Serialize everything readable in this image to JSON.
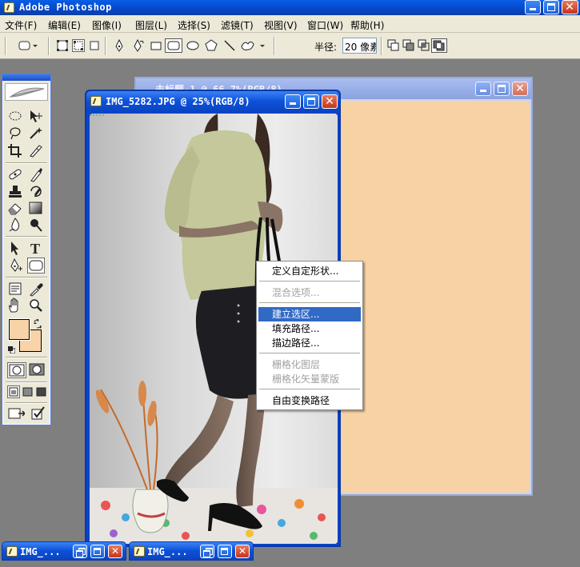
{
  "app": {
    "title": "Adobe Photoshop",
    "icon": "photoshop-feather-icon"
  },
  "menubar": {
    "items": [
      {
        "label": "文件(F)"
      },
      {
        "label": "编辑(E)"
      },
      {
        "label": "图像(I)"
      },
      {
        "label": "图层(L)"
      },
      {
        "label": "选择(S)"
      },
      {
        "label": "滤镜(T)"
      },
      {
        "label": "视图(V)"
      },
      {
        "label": "窗口(W)"
      },
      {
        "label": "帮助(H)"
      }
    ]
  },
  "options": {
    "radius_label": "半径:",
    "radius_value": "20 像素",
    "tool_preset_icon": "rounded-rectangle-preset-icon",
    "mode_icons": [
      "shape-layers-icon",
      "paths-icon",
      "fill-pixels-icon"
    ],
    "shape_icons": [
      "pen-icon",
      "freeform-pen-icon",
      "rectangle-icon",
      "rounded-rectangle-icon",
      "ellipse-icon",
      "polygon-icon",
      "line-icon",
      "custom-shape-icon"
    ],
    "combine_icons": [
      "add-to-shape-icon",
      "subtract-shape-icon",
      "intersect-shape-icon",
      "exclude-shape-icon"
    ]
  },
  "toolbox": {
    "foreground_color": "#f8d2a8",
    "background_color": "#f8d2a8",
    "active_tool": "rounded-rectangle-tool"
  },
  "documents": {
    "front": {
      "title": "IMG_5282.JPG @ 25%(RGB/8)"
    },
    "back": {
      "title": "未标题-1 @ 66.7%(RGB/8)",
      "canvas_color": "#f7d2a4"
    }
  },
  "context_menu": {
    "items": [
      {
        "label": "定义自定形状...",
        "state": "enabled"
      },
      {
        "label": "混合选项...",
        "state": "disabled"
      },
      {
        "label": "建立选区...",
        "state": "highlighted"
      },
      {
        "label": "填充路径...",
        "state": "enabled"
      },
      {
        "label": "描边路径...",
        "state": "enabled"
      },
      {
        "label": "栅格化图层",
        "state": "disabled"
      },
      {
        "label": "栅格化矢量蒙版",
        "state": "disabled"
      },
      {
        "label": "自由变换路径",
        "state": "enabled"
      }
    ]
  },
  "minimized": [
    {
      "title": "IMG_..."
    },
    {
      "title": "IMG_..."
    }
  ],
  "colors": {
    "xp_title_blue": "#0c50d8",
    "menu_highlight": "#316ac5",
    "workspace_gray": "#7f7f7f"
  }
}
